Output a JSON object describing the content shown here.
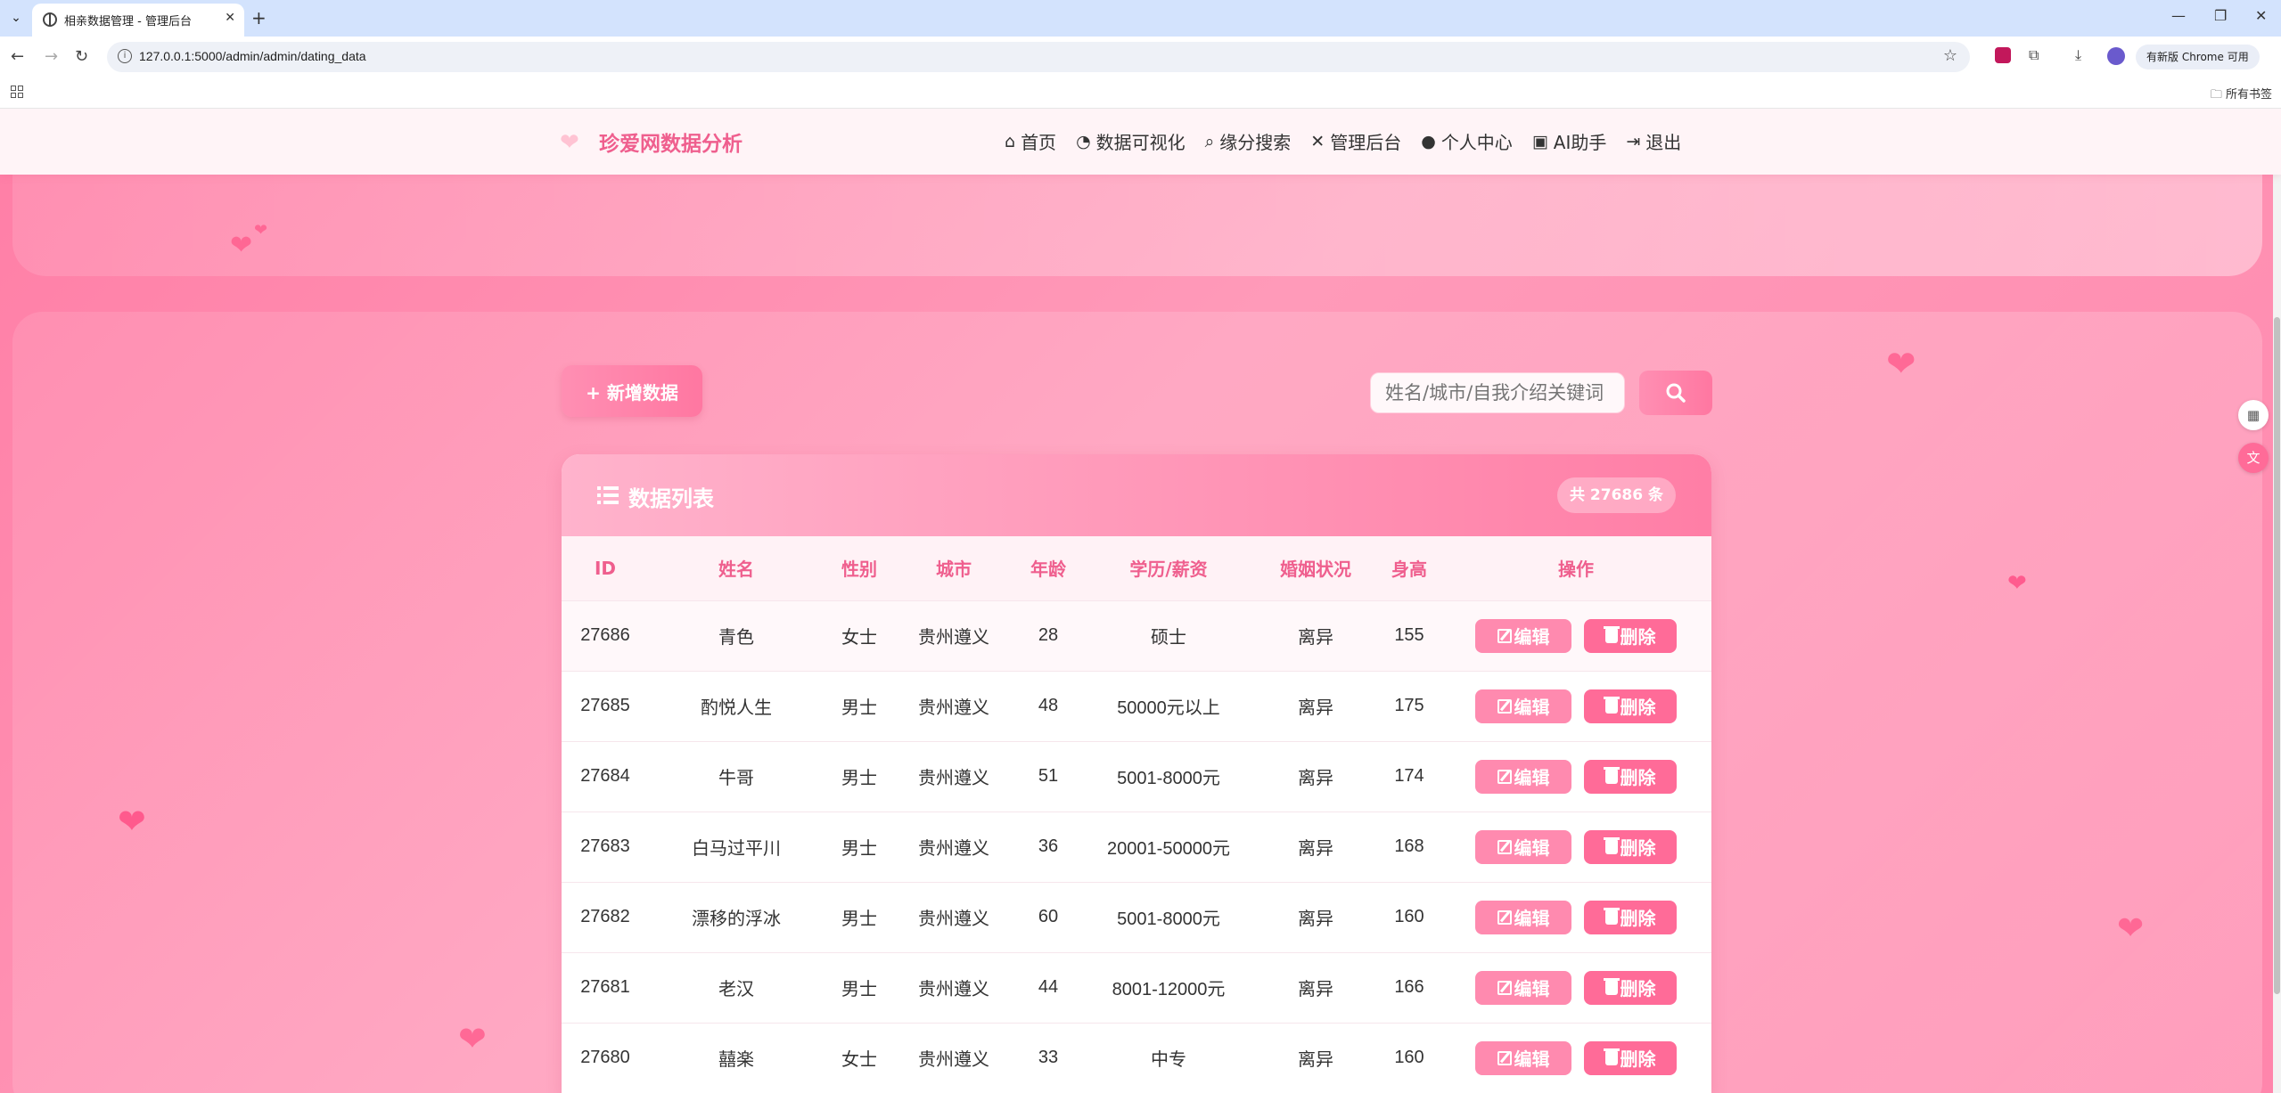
{
  "browser": {
    "tab_title": "相亲数据管理 - 管理后台",
    "url": "127.0.0.1:5000/admin/admin/dating_data",
    "update_label": "有新版 Chrome 可用",
    "bookmarks_label": "所有书签"
  },
  "site": {
    "brand": "珍爱网数据分析",
    "menu": [
      {
        "label": "首页",
        "icon": "home-icon"
      },
      {
        "label": "数据可视化",
        "icon": "chart-pie-icon"
      },
      {
        "label": "缘分搜索",
        "icon": "search-icon"
      },
      {
        "label": "管理后台",
        "icon": "tools-icon"
      },
      {
        "label": "个人中心",
        "icon": "user-icon"
      },
      {
        "label": "AI助手",
        "icon": "robot-icon"
      },
      {
        "label": "退出",
        "icon": "logout-icon"
      }
    ]
  },
  "toolbar": {
    "add_label": "+ 新增数据",
    "search_placeholder": "姓名/城市/自我介绍关键词"
  },
  "table": {
    "title": "数据列表",
    "total": "共 27686 条",
    "columns": [
      "ID",
      "姓名",
      "性别",
      "城市",
      "年龄",
      "学历/薪资",
      "婚姻状况",
      "身高",
      "操作"
    ],
    "edit_label": "编辑",
    "delete_label": "删除",
    "rows": [
      {
        "id": "27686",
        "name": "青色",
        "gender": "女士",
        "city": "贵州遵义",
        "age": "28",
        "edu": "硕士",
        "marital": "离异",
        "height": "155"
      },
      {
        "id": "27685",
        "name": "酌悦人生",
        "gender": "男士",
        "city": "贵州遵义",
        "age": "48",
        "edu": "50000元以上",
        "marital": "离异",
        "height": "175"
      },
      {
        "id": "27684",
        "name": "牛哥",
        "gender": "男士",
        "city": "贵州遵义",
        "age": "51",
        "edu": "5001-8000元",
        "marital": "离异",
        "height": "174"
      },
      {
        "id": "27683",
        "name": "白马过平川",
        "gender": "男士",
        "city": "贵州遵义",
        "age": "36",
        "edu": "20001-50000元",
        "marital": "离异",
        "height": "168"
      },
      {
        "id": "27682",
        "name": "漂移的浮冰",
        "gender": "男士",
        "city": "贵州遵义",
        "age": "60",
        "edu": "5001-8000元",
        "marital": "离异",
        "height": "160"
      },
      {
        "id": "27681",
        "name": "老汉",
        "gender": "男士",
        "city": "贵州遵义",
        "age": "44",
        "edu": "8001-12000元",
        "marital": "离异",
        "height": "166"
      },
      {
        "id": "27680",
        "name": "囍楽",
        "gender": "女士",
        "city": "贵州遵义",
        "age": "33",
        "edu": "中专",
        "marital": "离异",
        "height": "160"
      }
    ]
  },
  "colors": {
    "accent": "#ef5f8e",
    "button": "#ff8aaf",
    "delete": "#ff6b98"
  }
}
